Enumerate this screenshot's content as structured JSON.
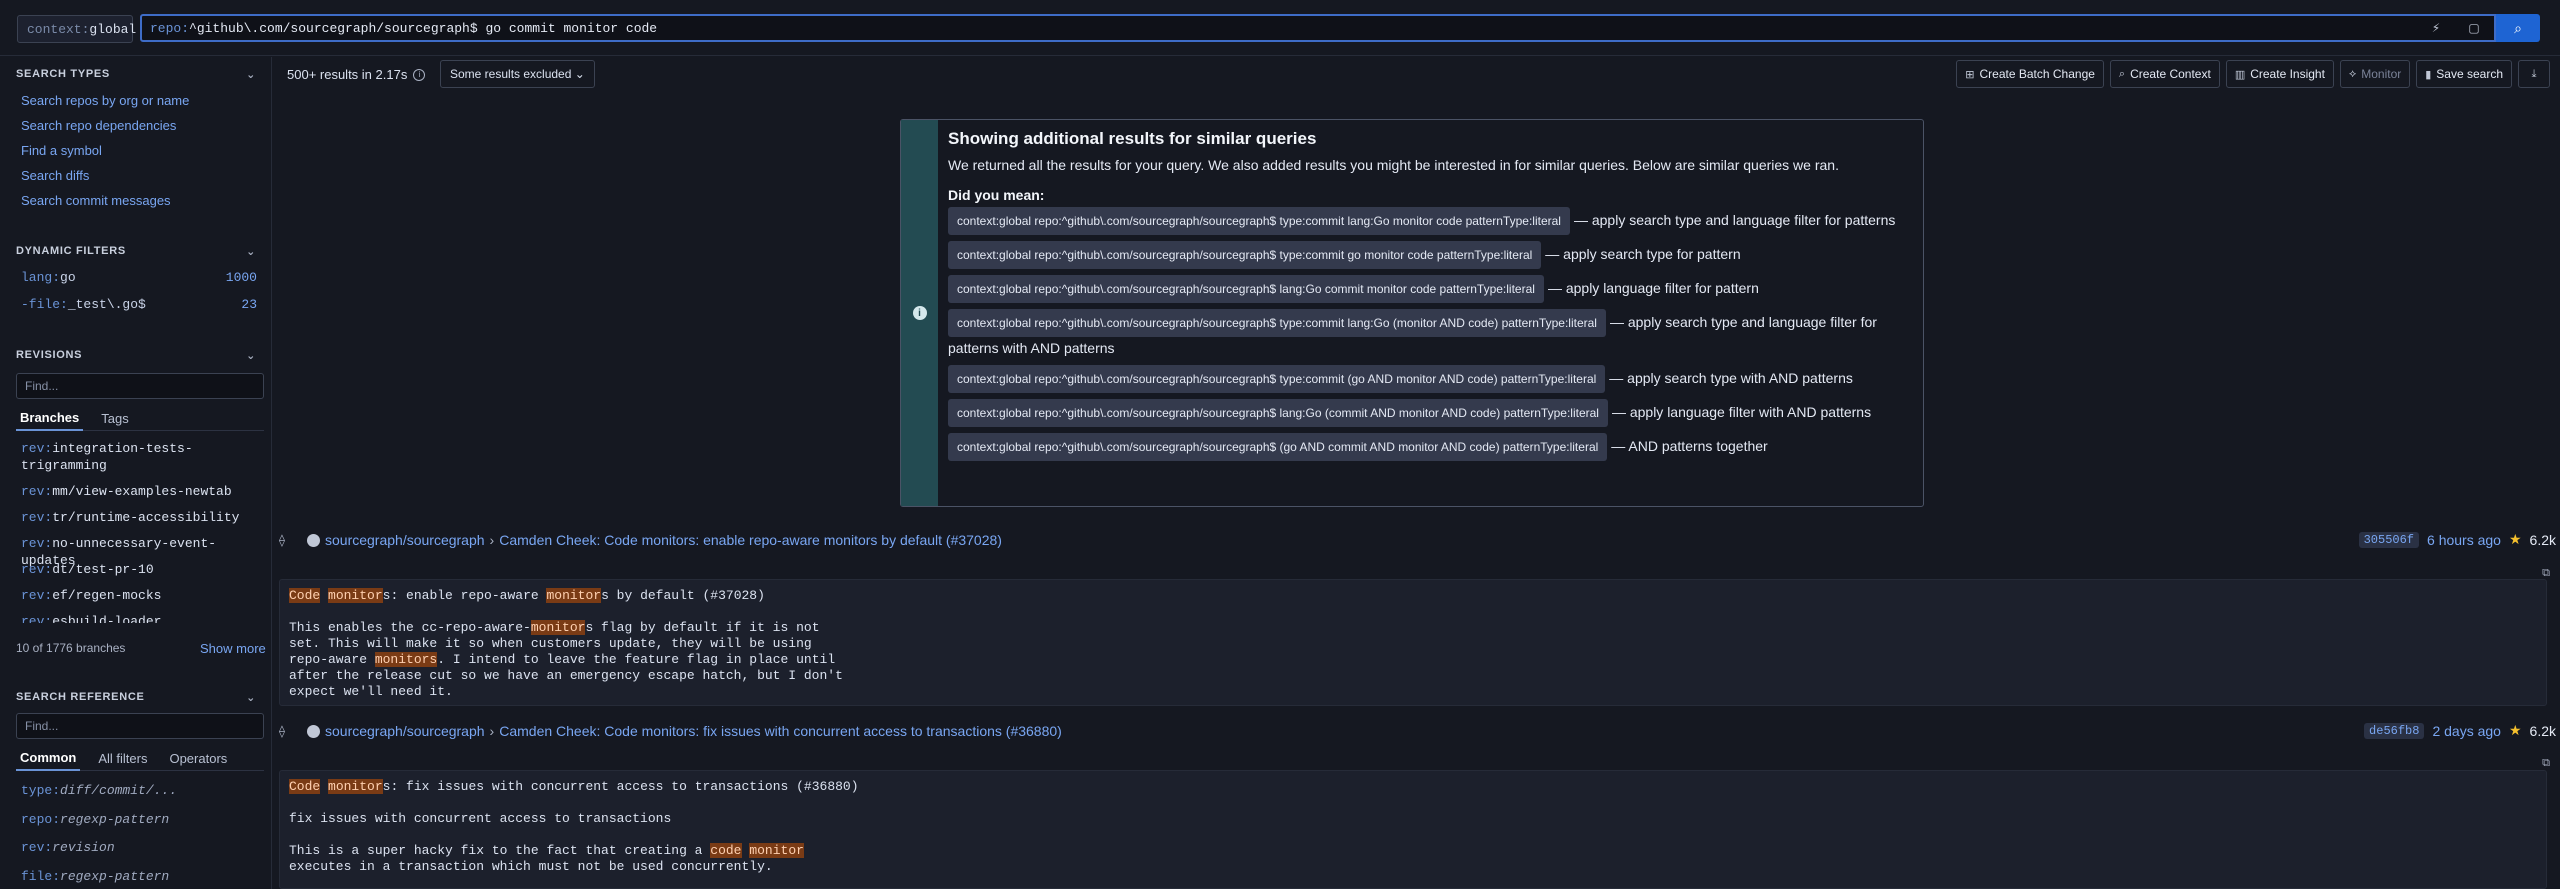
{
  "search": {
    "context_key": "context:",
    "context_value": "global",
    "query_filter_key": "repo:",
    "query_filter_value": "^github\\.com/sourcegraph/sourcegraph$",
    "query_terms": " go commit monitor code"
  },
  "sidebar": {
    "search_types": {
      "title": "SEARCH TYPES",
      "items": [
        "Search repos by org or name",
        "Search repo dependencies",
        "Find a symbol",
        "Search diffs",
        "Search commit messages"
      ]
    },
    "dynamic_filters": {
      "title": "DYNAMIC FILTERS",
      "items": [
        {
          "key": "lang:",
          "value": "go",
          "count": "1000"
        },
        {
          "key": "-file:",
          "value": "_test\\.go$",
          "count": "23"
        }
      ]
    },
    "revisions": {
      "title": "REVISIONS",
      "find_placeholder": "Find...",
      "tabs": [
        "Branches",
        "Tags"
      ],
      "items": [
        {
          "key": "rev:",
          "value": "integration-tests-trigramming"
        },
        {
          "key": "rev:",
          "value": "mm/view-examples-newtab"
        },
        {
          "key": "rev:",
          "value": "tr/runtime-accessibility"
        },
        {
          "key": "rev:",
          "value": "no-unnecessary-event-updates"
        },
        {
          "key": "rev:",
          "value": "dt/test-pr-10"
        },
        {
          "key": "rev:",
          "value": "ef/regen-mocks"
        },
        {
          "key": "rev:",
          "value": "esbuild-loader"
        }
      ],
      "summary": "10 of 1776 branches",
      "show_more": "Show more"
    },
    "search_reference": {
      "title": "SEARCH REFERENCE",
      "find_placeholder": "Find...",
      "tabs": [
        "Common",
        "All filters",
        "Operators"
      ],
      "items": [
        {
          "key": "type:",
          "value": "diff/commit/..."
        },
        {
          "key": "repo:",
          "value": "regexp-pattern"
        },
        {
          "key": "rev:",
          "value": "revision"
        },
        {
          "key": "file:",
          "value": "regexp-pattern"
        }
      ]
    }
  },
  "results_bar": {
    "count": "500+ results in 2.17s",
    "excluded": "Some results excluded",
    "actions": [
      "Create Batch Change",
      "Create Context",
      "Create Insight",
      "Monitor",
      "Save search"
    ]
  },
  "alert": {
    "title": "Showing additional results for similar queries",
    "description": "We returned all the results for your query. We also added results you might be interested in for similar queries. Below are similar queries we ran.",
    "did_you_mean": "Did you mean:",
    "suggestions": [
      {
        "query": "context:global repo:^github\\.com/sourcegraph/sourcegraph$ type:commit lang:Go monitor code patternType:literal",
        "desc": "— apply search type and language filter for patterns"
      },
      {
        "query": "context:global repo:^github\\.com/sourcegraph/sourcegraph$ type:commit go monitor code patternType:literal",
        "desc": "— apply search type for pattern"
      },
      {
        "query": "context:global repo:^github\\.com/sourcegraph/sourcegraph$ lang:Go commit monitor code patternType:literal",
        "desc": "— apply language filter for pattern"
      },
      {
        "query": "context:global repo:^github\\.com/sourcegraph/sourcegraph$ type:commit lang:Go (monitor AND code) patternType:literal",
        "desc": "— apply search type and language filter for patterns with AND patterns"
      },
      {
        "query": "context:global repo:^github\\.com/sourcegraph/sourcegraph$ type:commit (go AND monitor AND code) patternType:literal",
        "desc": "— apply search type with AND patterns"
      },
      {
        "query": "context:global repo:^github\\.com/sourcegraph/sourcegraph$ lang:Go (commit AND monitor AND code) patternType:literal",
        "desc": "— apply language filter with AND patterns"
      },
      {
        "query": "context:global repo:^github\\.com/sourcegraph/sourcegraph$ (go AND commit AND monitor AND code) patternType:literal",
        "desc": "— AND patterns together"
      }
    ]
  },
  "results": [
    {
      "repo": "sourcegraph/sourcegraph",
      "author": "Camden Cheek",
      "title": "Code monitors: enable repo-aware monitors by default (#37028)",
      "hash": "305506f",
      "time": "6 hours ago",
      "stars": "6.2k"
    },
    {
      "repo": "sourcegraph/sourcegraph",
      "author": "Camden Cheek",
      "title": "Code monitors: fix issues with concurrent access to transactions (#36880)",
      "hash": "de56fb8",
      "time": "2 days ago",
      "stars": "6.2k"
    }
  ],
  "result_bodies": {
    "r1": {
      "l1a": "Code",
      "l1b": " ",
      "l1c": "monitor",
      "l1d": "s: enable repo-aware ",
      "l1e": "monitor",
      "l1f": "s by default (#37028)",
      "l2": "This enables the cc-repo-aware-",
      "l2h": "monitor",
      "l2t": "s flag by default if it is not",
      "l3": "set. This will make it so when customers update, they will be using",
      "l4a": "repo-aware ",
      "l4h": "monitors",
      "l4t": ". I intend to leave the feature flag in place until",
      "l5": "after the release cut so we have an emergency escape hatch, but I don't",
      "l6": "expect we'll need it."
    },
    "r2": {
      "l1a": "Code",
      "l1c": "monitor",
      "l1d": "s: fix issues with concurrent access to transactions (#36880)",
      "l2": "fix issues with concurrent access to transactions",
      "l3a": "This is a super hacky fix to the fact that creating a ",
      "l3h1": "code",
      "l3h2": "monitor",
      "l4": "executes in a transaction which must not be used concurrently."
    }
  },
  "colors": {
    "accent": "#1e64d3",
    "link": "#79a6f2",
    "highlight": "#7a3b15",
    "alert_side": "#234b52"
  }
}
